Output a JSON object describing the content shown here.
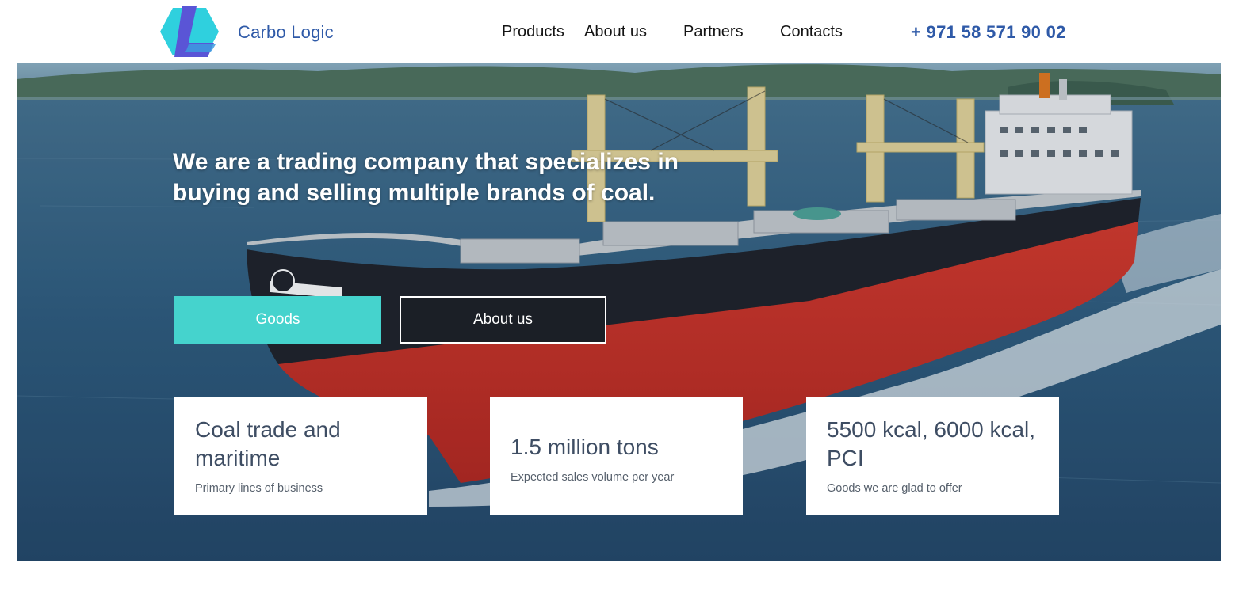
{
  "header": {
    "brand": "Carbo Logic",
    "nav": [
      {
        "label": "Products"
      },
      {
        "label": "About us"
      },
      {
        "label": "Partners"
      },
      {
        "label": "Contacts"
      }
    ],
    "phone": "+ 971 58 571 90 02"
  },
  "hero": {
    "headline": "We are a trading company that specializes in buying and selling multiple brands of coal.",
    "buttons": {
      "goods": "Goods",
      "about": "About us"
    },
    "cards": [
      {
        "title": "Coal trade and maritime",
        "subtitle": "Primary lines of business"
      },
      {
        "title": "1.5 million tons",
        "subtitle": "Expected sales volume per year"
      },
      {
        "title": "5500 kcal, 6000 kcal, PCI",
        "subtitle": "Goods we are glad to offer"
      }
    ]
  },
  "colors": {
    "brand_blue": "#2f5aa8",
    "accent_teal": "#45d3cd",
    "card_text": "#3e4d63"
  },
  "icons": {
    "logo": "carbo-logic-logo-icon"
  }
}
